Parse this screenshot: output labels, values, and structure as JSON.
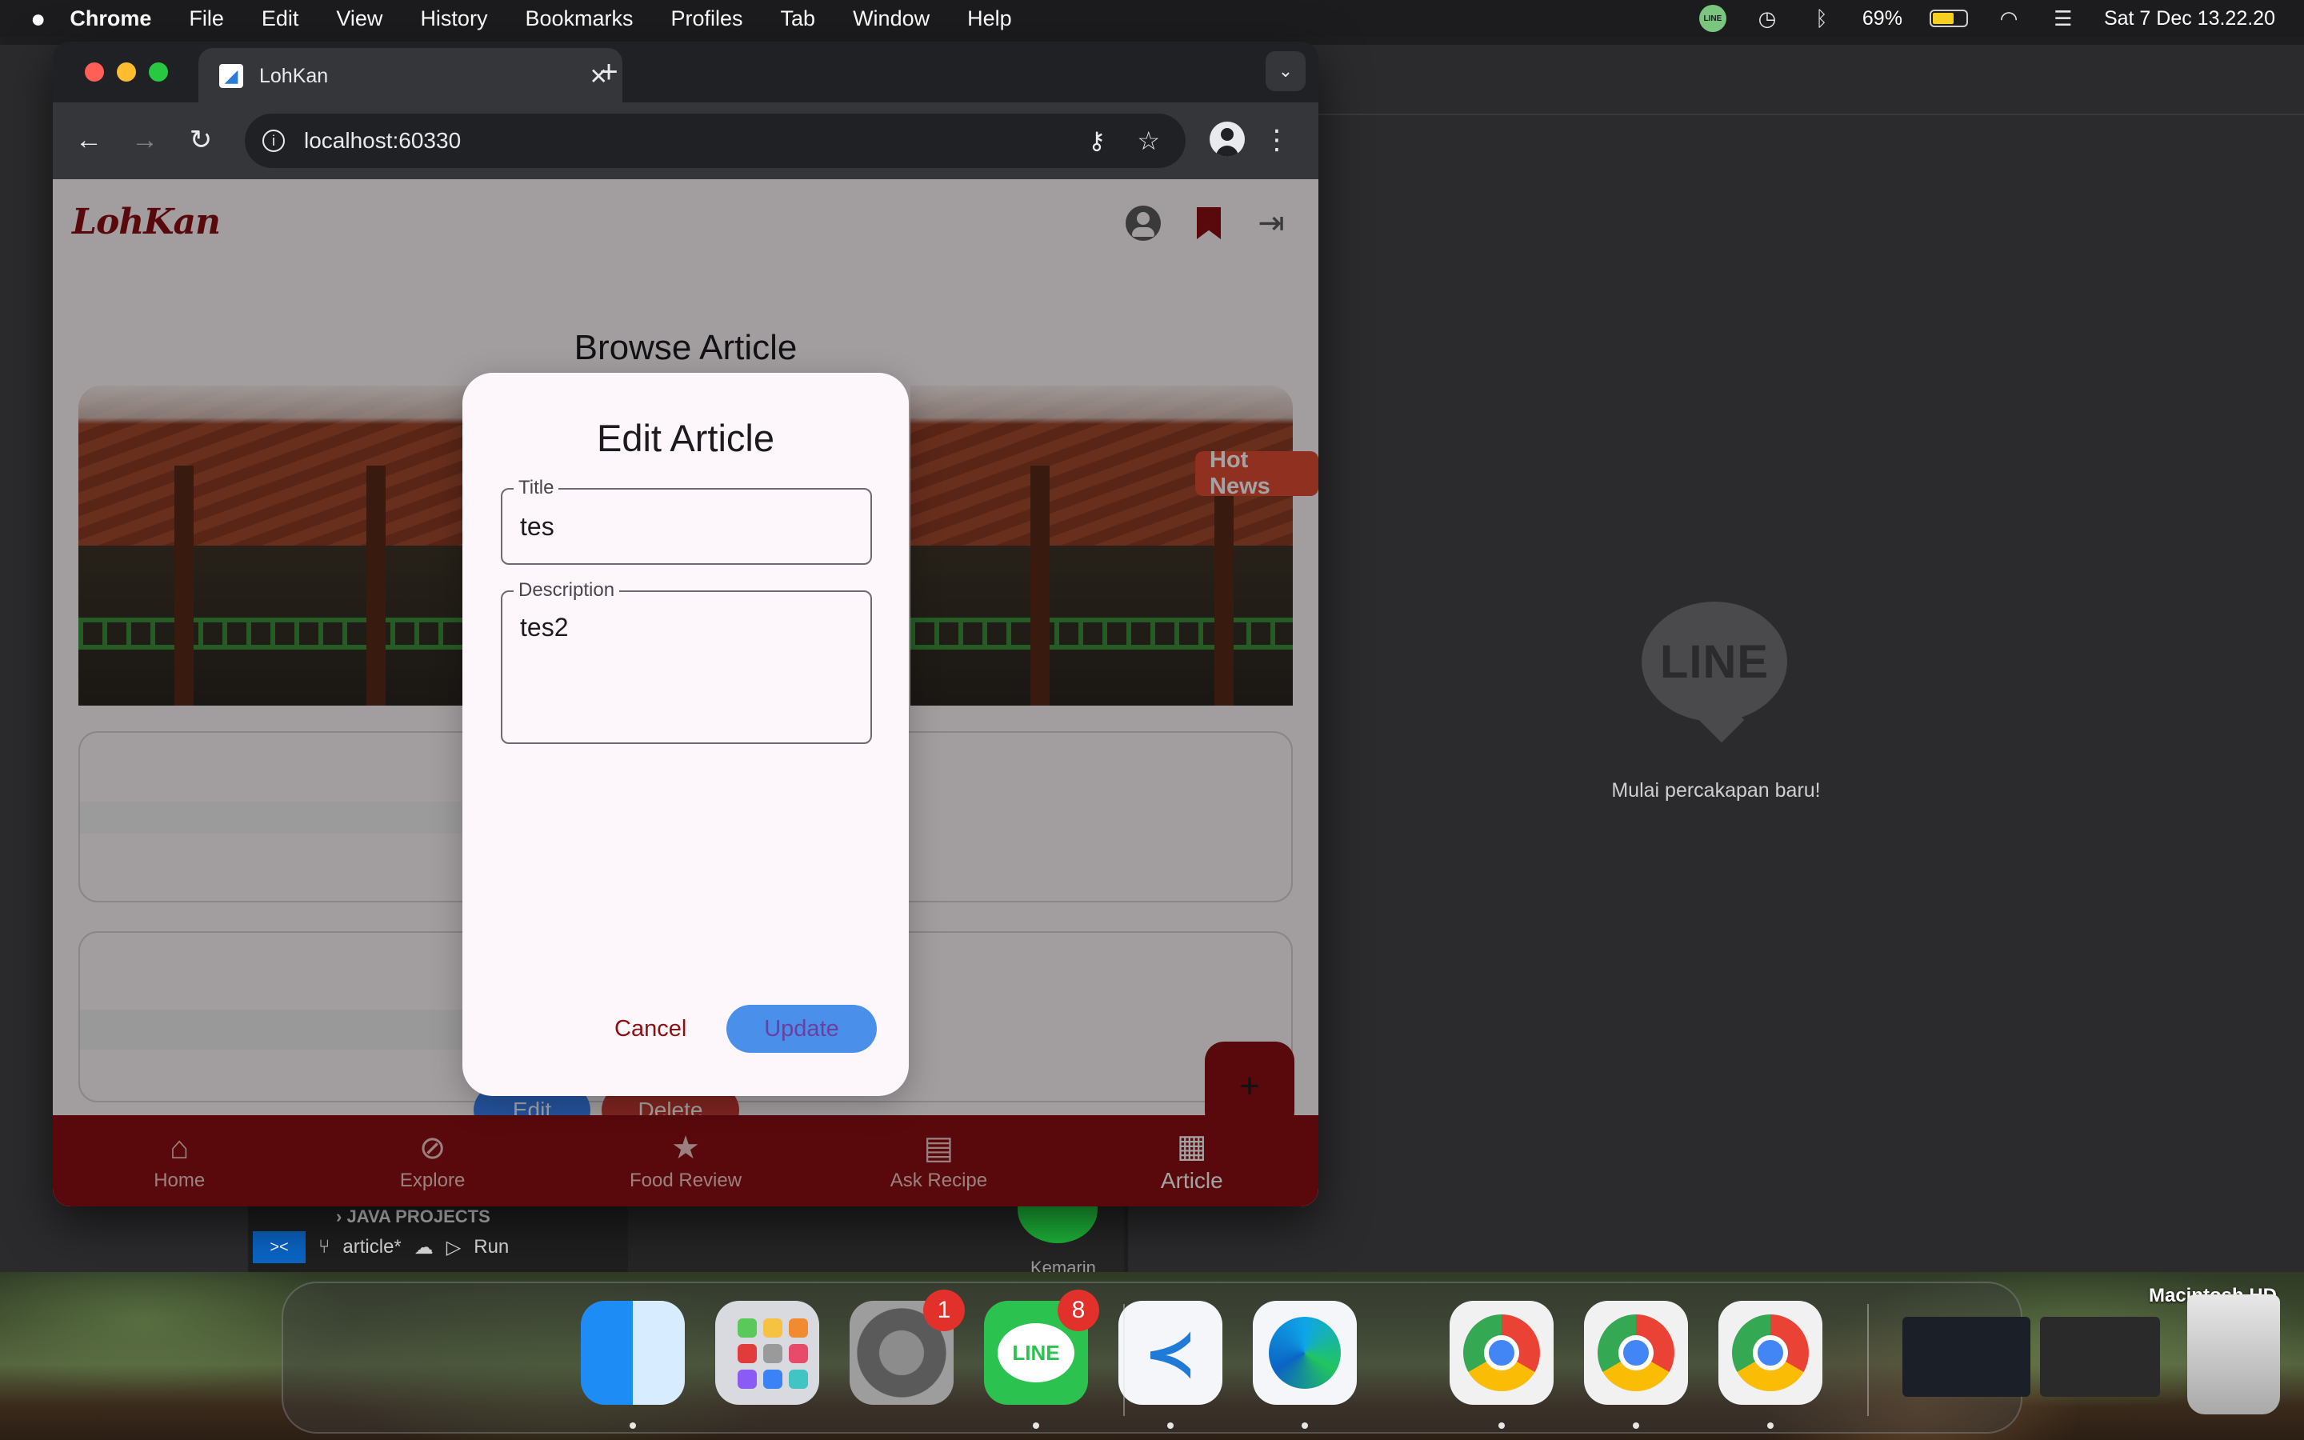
{
  "menubar": {
    "app_name": "Chrome",
    "items": [
      "File",
      "Edit",
      "View",
      "History",
      "Bookmarks",
      "Profiles",
      "Tab",
      "Window",
      "Help"
    ],
    "battery": "69%",
    "datetime": "Sat 7 Dec  13.22.20"
  },
  "chrome": {
    "tab_title": "LohKan",
    "url": "localhost:60330"
  },
  "app": {
    "logo": "LohKan",
    "page_title": "Browse Article",
    "hot_news_badge": "Hot News",
    "edit_label": "Edit",
    "delete_label": "Delete",
    "fab_label": "+",
    "nav": [
      {
        "label": "Home",
        "icon": "home-icon"
      },
      {
        "label": "Explore",
        "icon": "compass-icon"
      },
      {
        "label": "Food Review",
        "icon": "star-icon"
      },
      {
        "label": "Ask Recipe",
        "icon": "chat-icon"
      },
      {
        "label": "Article",
        "icon": "article-icon",
        "active": true
      }
    ]
  },
  "dialog": {
    "title": "Edit Article",
    "title_field": {
      "label": "Title",
      "value": "tes"
    },
    "description_field": {
      "label": "Description",
      "value": "tes2"
    },
    "cancel_label": "Cancel",
    "update_label": "Update"
  },
  "line_window": {
    "logo": "LINE",
    "empty_message": "Mulai percakapan baru!",
    "time_label": "Kemarin"
  },
  "vscode": {
    "section": "JAVA PROJECTS",
    "branch": "article*",
    "run_label": "Run"
  },
  "desktop": {
    "drive_label": "Macintosh HD"
  },
  "dock": {
    "settings_badge": "1",
    "line_badge": "8",
    "line_label": "LINE"
  },
  "colors": {
    "brand": "#8b0f13",
    "dialog_bg": "#fdf7fc",
    "update_button": "#4a90ea",
    "hot_news": "#e24b32"
  }
}
